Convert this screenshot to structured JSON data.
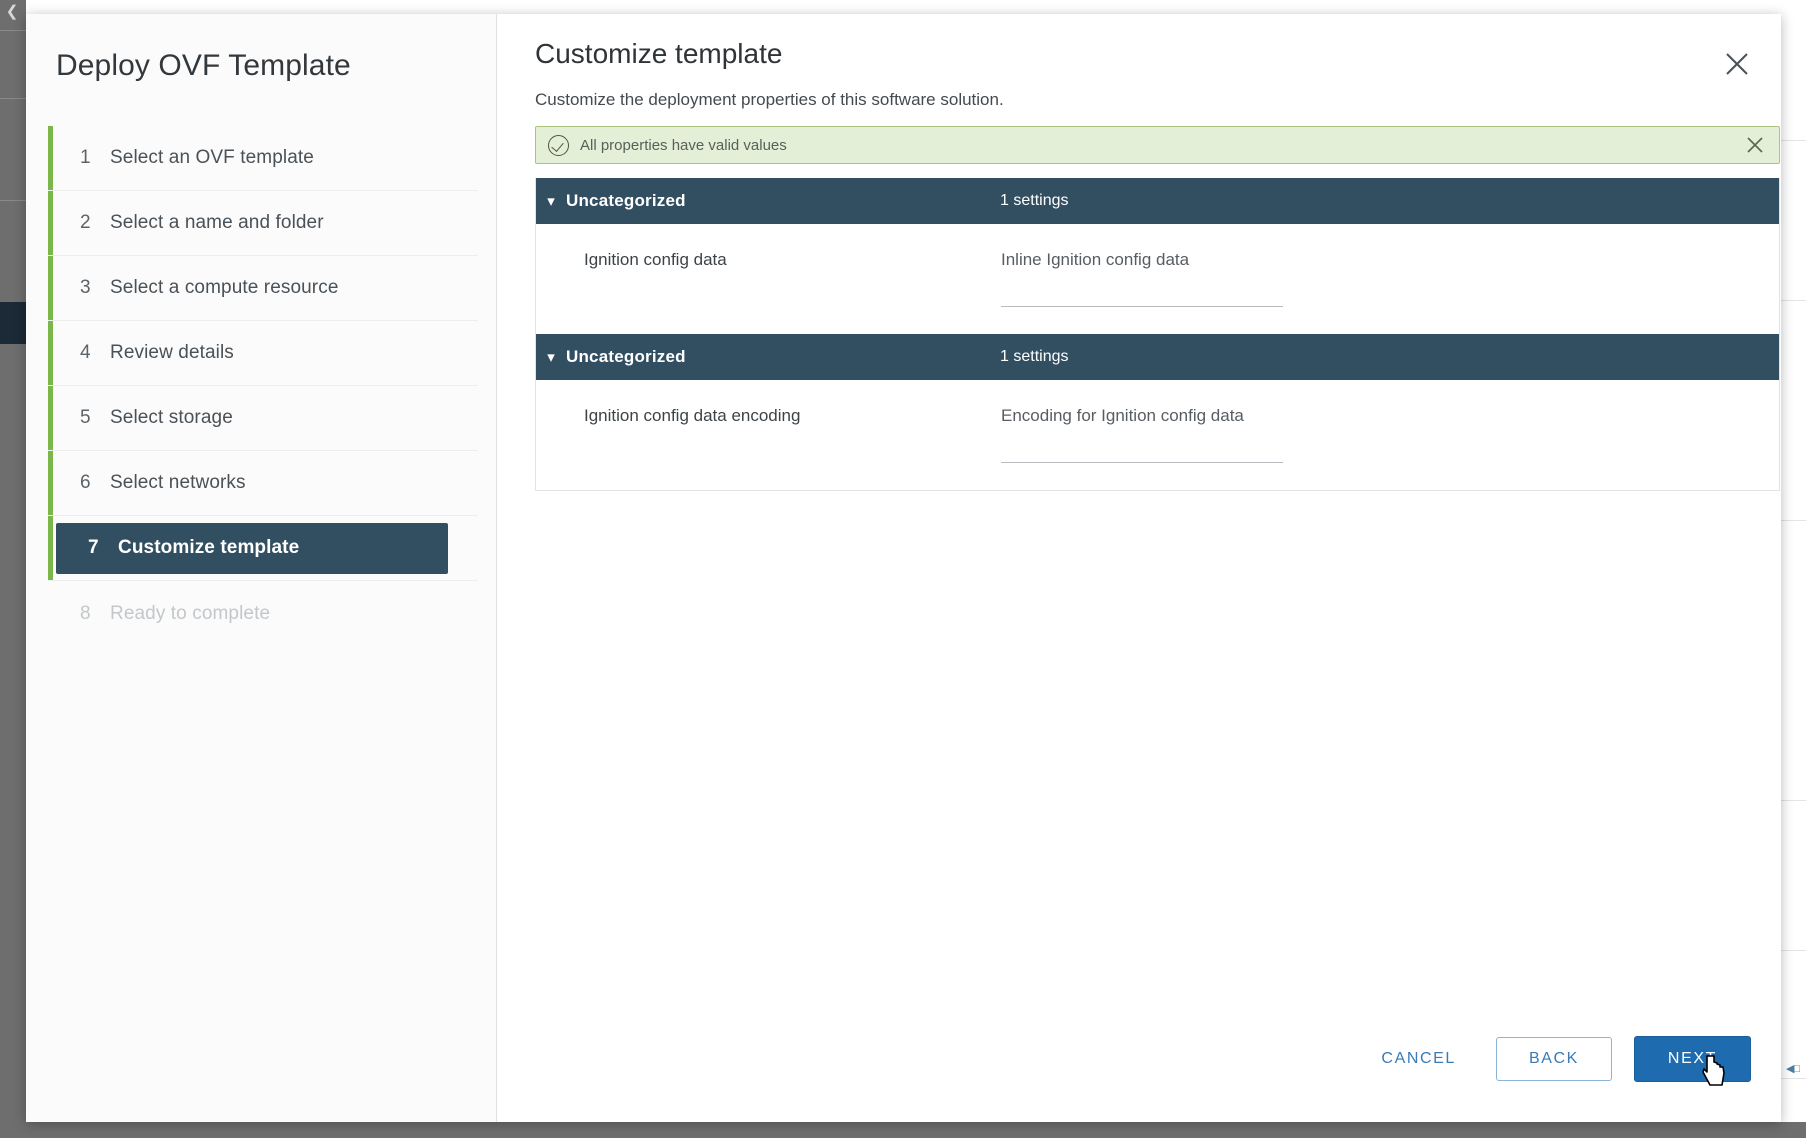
{
  "background": {
    "rail_chevron_icon": "chevron-left-icon",
    "right_mark": "◀□"
  },
  "wizard": {
    "title": "Deploy OVF Template",
    "accent_color": "#7ab648",
    "active_color": "#324f62",
    "steps": [
      {
        "num": "1",
        "label": "Select an OVF template",
        "state": "done"
      },
      {
        "num": "2",
        "label": "Select a name and folder",
        "state": "done"
      },
      {
        "num": "3",
        "label": "Select a compute resource",
        "state": "done"
      },
      {
        "num": "4",
        "label": "Review details",
        "state": "done"
      },
      {
        "num": "5",
        "label": "Select storage",
        "state": "done"
      },
      {
        "num": "6",
        "label": "Select networks",
        "state": "done"
      },
      {
        "num": "7",
        "label": "Customize template",
        "state": "active"
      },
      {
        "num": "8",
        "label": "Ready to complete",
        "state": "disabled"
      }
    ]
  },
  "content": {
    "title": "Customize template",
    "subtitle": "Customize the deployment properties of this software solution.",
    "close_icon": "close-icon"
  },
  "alert": {
    "icon": "success-check-circle-icon",
    "message": "All properties have valid values",
    "close_icon": "close-icon",
    "background_color": "#e4efd7",
    "border_color": "#aac47f"
  },
  "property_groups": [
    {
      "chevron_icon": "chevron-down-icon",
      "name": "Uncategorized",
      "count_label": "1 settings",
      "rows": [
        {
          "label": "Ignition config data",
          "description": "Inline Ignition config data",
          "value": "",
          "placeholder": ""
        }
      ]
    },
    {
      "chevron_icon": "chevron-down-icon",
      "name": "Uncategorized",
      "count_label": "1 settings",
      "rows": [
        {
          "label": "Ignition config data encoding",
          "description": "Encoding for Ignition config data",
          "value": "",
          "placeholder": ""
        }
      ]
    }
  ],
  "footer": {
    "cancel_label": "CANCEL",
    "back_label": "BACK",
    "next_label": "NEXT",
    "primary_color": "#1f6bb0",
    "link_color": "#3b7ab5"
  }
}
